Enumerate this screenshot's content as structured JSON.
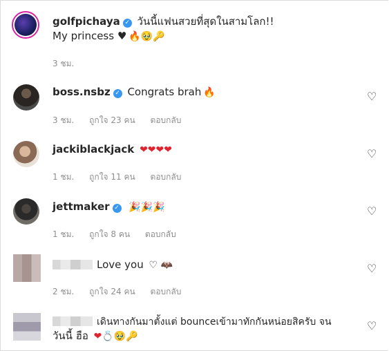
{
  "post": {
    "username": "golfpichaya",
    "caption": "วันนี้แฟนสวยที่สุดในสามโลก!!",
    "caption_line2": "My princess ♥",
    "caption_emojis": "🔥🥹🔑",
    "time": "3 ชม."
  },
  "comments": [
    {
      "username": "boss.nsbz",
      "text": "Congrats brah",
      "emojis": "🔥",
      "time": "3 ชม.",
      "likes": "ถูกใจ 23 คน",
      "reply": "ตอบกลับ"
    },
    {
      "username": "jackiblackjack",
      "text": "",
      "emojis": "❤❤❤❤",
      "time": "1 ชม.",
      "likes": "ถูกใจ 11 คน",
      "reply": "ตอบกลับ"
    },
    {
      "username": "jettmaker",
      "text": "",
      "emojis": "🎉🎉🎉",
      "time": "1 ชม.",
      "likes": "ถูกใจ 8 คน",
      "reply": "ตอบกลับ"
    },
    {
      "username": "",
      "text": "Love you",
      "emojis": "♡ 🦇",
      "time": "2 ชม.",
      "likes": "ถูกใจ 24 คน",
      "reply": "ตอบกลับ"
    },
    {
      "username": "",
      "text": "เดินทางกันมาตั้งแต่ bounceเข้ามาทักกันหน่อยสิครับ จน",
      "text_line2": "วันนี้ ฮือ",
      "emojis": "❤💍🥹🔑"
    }
  ],
  "icons": {
    "verified": "verified-badge-icon",
    "like": "heart-outline-icon"
  },
  "colors": {
    "verified": "#3897f0",
    "meta": "#8e8e8e",
    "heart": "#e0242f"
  }
}
